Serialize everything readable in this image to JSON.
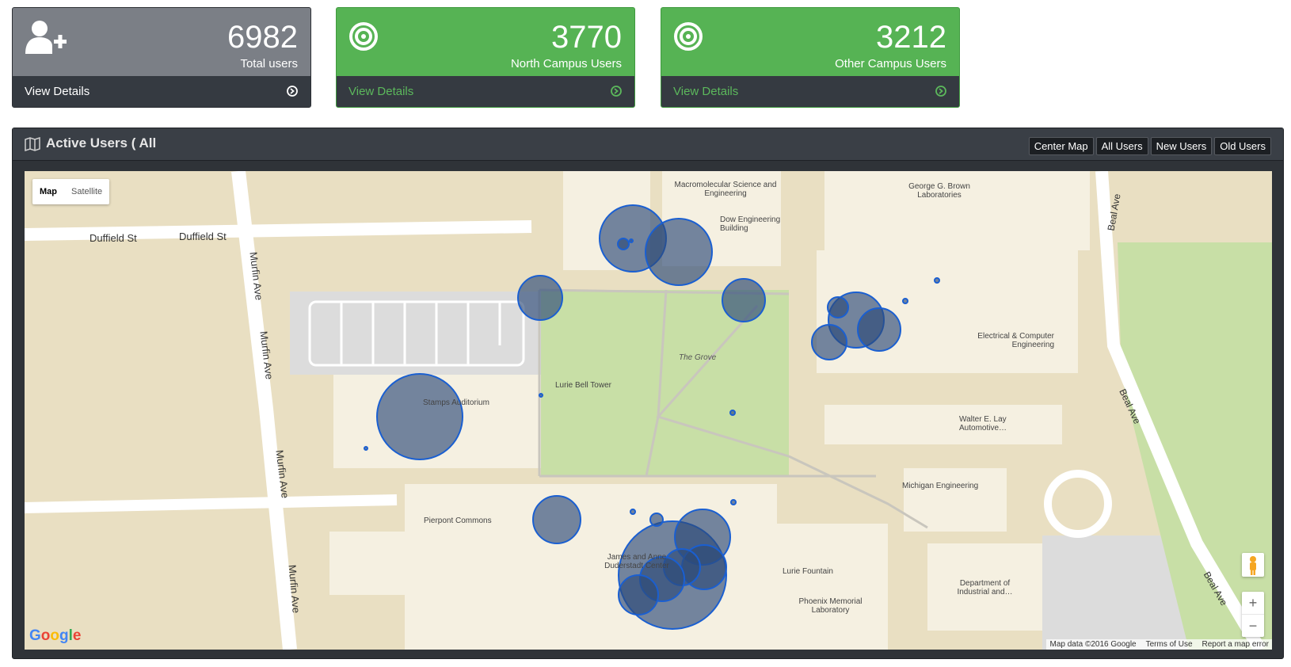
{
  "cards": [
    {
      "count": "6982",
      "label": "Total users",
      "link": "View Details"
    },
    {
      "count": "3770",
      "label": "North Campus Users",
      "link": "View Details"
    },
    {
      "count": "3212",
      "label": "Other Campus Users",
      "link": "View Details"
    }
  ],
  "panel": {
    "title": "Active Users ( All",
    "buttons": [
      "Center Map",
      "All Users",
      "New Users",
      "Old Users"
    ]
  },
  "map": {
    "types": [
      "Map",
      "Satellite"
    ],
    "selected_type": "Map",
    "streets": [
      "Duffield St",
      "Duffield St",
      "Murfin Ave",
      "Murfin Ave",
      "Murfin Ave",
      "Murfin Ave",
      "Beal Ave",
      "Beal Ave",
      "Beal Ave"
    ],
    "places": [
      "Macromolecular Science and Engineering",
      "Dow Engineering Building",
      "George G. Brown Laboratories",
      "Electrical & Computer Engineering",
      "The Grove",
      "Lurie Bell Tower",
      "Stamps Auditorium",
      "Walter E. Lay Automotive…",
      "Michigan Engineering",
      "Pierpont Commons",
      "James and Anne Duderstadt Center",
      "Lurie Fountain",
      "Phoenix Memorial Laboratory",
      "Department of Industrial and…"
    ],
    "footer": [
      "Map data ©2016 Google",
      "Terms of Use",
      "Report a map error"
    ],
    "logo": "Google",
    "zoom_in": "+",
    "zoom_out": "−"
  },
  "colors": {
    "green": "#56b354",
    "gray_card": "#7b7f86",
    "dark": "#353a41",
    "marker_fill": "#2d4a78",
    "marker_stroke": "#1a5fd1",
    "grass": "#c8dfa6",
    "building": "#f5f0e1"
  }
}
